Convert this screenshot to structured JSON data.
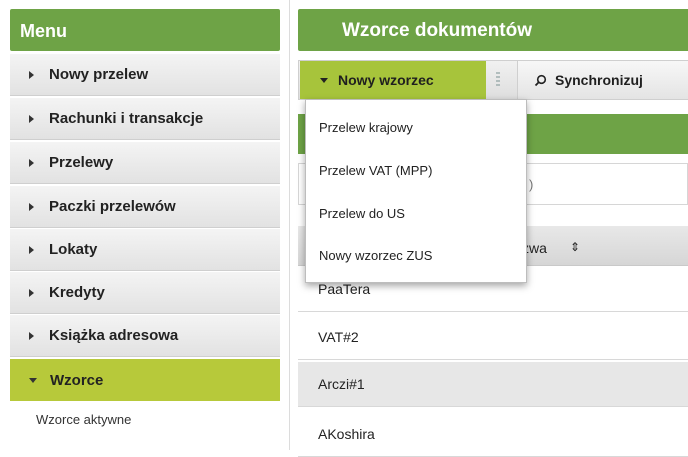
{
  "sidebar": {
    "title": "Menu",
    "items": [
      {
        "label": "Nowy przelew"
      },
      {
        "label": "Rachunki i transakcje"
      },
      {
        "label": "Przelewy"
      },
      {
        "label": "Paczki przelewów"
      },
      {
        "label": "Lokaty"
      },
      {
        "label": "Kredyty"
      },
      {
        "label": "Książka adresowa"
      },
      {
        "label": "Wzorce"
      }
    ],
    "active_index": 7,
    "submenu": {
      "label": "Wzorce aktywne"
    }
  },
  "main": {
    "title": "Wzorce dokumentów",
    "toolbar": {
      "new_template_label": "Nowy wzorzec",
      "sync_label": "Synchronizuj"
    },
    "filter_text": ")",
    "column_header": {
      "label": "zwa",
      "sort_icon": "sort-updown-icon"
    },
    "rows": [
      {
        "name": "PaaTera"
      },
      {
        "name": "VAT#2"
      },
      {
        "name": "Arczi#1"
      },
      {
        "name": "AKoshira"
      }
    ]
  },
  "dropdown": {
    "items": [
      {
        "label": "Przelew krajowy"
      },
      {
        "label": "Przelew VAT (MPP)"
      },
      {
        "label": "Przelew do US"
      },
      {
        "label": "Nowy wzorzec ZUS"
      }
    ]
  },
  "colors": {
    "header_green": "#6ea346",
    "active_lime": "#b7c93a",
    "button_lime": "#a7c43b"
  }
}
